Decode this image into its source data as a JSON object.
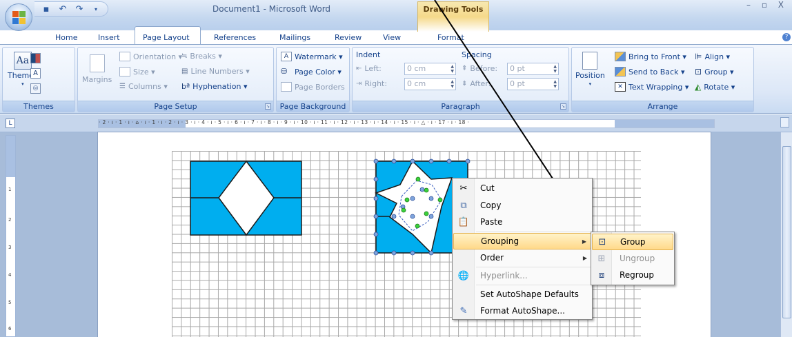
{
  "window": {
    "title": "Document1 - Microsoft Word",
    "contextual_tab_group": "Drawing Tools",
    "controls": "– ▫ X"
  },
  "tabs": [
    "Home",
    "Insert",
    "Page Layout",
    "References",
    "Mailings",
    "Review",
    "View",
    "Format"
  ],
  "active_tab": "Page Layout",
  "ribbon": {
    "themes": {
      "label": "Themes",
      "group": "Themes"
    },
    "page_setup": {
      "group": "Page Setup",
      "margins": "Margins",
      "orientation": "Orientation ▾",
      "size": "Size ▾",
      "columns": "Columns ▾",
      "breaks": "Breaks ▾",
      "line_numbers": "Line Numbers ▾",
      "hyphenation": "Hyphenation ▾"
    },
    "page_background": {
      "group": "Page Background",
      "watermark": "Watermark ▾",
      "page_color": "Page Color ▾",
      "page_borders": "Page Borders"
    },
    "paragraph": {
      "group": "Paragraph",
      "indent": "Indent",
      "left_label": "Left:",
      "left_value": "0 cm",
      "right_label": "Right:",
      "right_value": "0 cm",
      "spacing": "Spacing",
      "before_label": "Before:",
      "before_value": "0 pt",
      "after_label": "After:",
      "after_value": "0 pt"
    },
    "arrange": {
      "group": "Arrange",
      "position": "Position",
      "bring_to_front": "Bring to Front ▾",
      "send_to_back": "Send to Back ▾",
      "text_wrapping": "Text Wrapping ▾",
      "align": "Align ▾",
      "group_btn": "Group ▾",
      "rotate": "Rotate ▾"
    }
  },
  "ruler": {
    "text": "· 2 · ı · 1 · ı · ⌂ · ı · 1 · ı · 2 · ı · 3 · ı · 4 · ı · 5 · ı · 6 · ı · 7 · ı · 8 · ı · 9 · ı · 10 · ı · 11 · ı · 12 · ı · 13 · ı · 14 · ı · 15 · ı · △ · ı · 17 · ı · 18 ·",
    "vticks": [
      "1",
      "2",
      "3",
      "4",
      "5",
      "6"
    ]
  },
  "context_menu": {
    "items": [
      {
        "label": "Cut",
        "icon": "scissors-icon",
        "accel": "t"
      },
      {
        "label": "Copy",
        "icon": "copy-icon"
      },
      {
        "label": "Paste",
        "icon": "paste-icon"
      },
      {
        "label": "Grouping",
        "icon": "",
        "submenu": true,
        "highlighted": true
      },
      {
        "label": "Order",
        "icon": "",
        "submenu": true
      },
      {
        "label": "Hyperlink...",
        "icon": "hyperlink-icon",
        "disabled": true
      },
      {
        "label": "Set AutoShape Defaults",
        "icon": ""
      },
      {
        "label": "Format AutoShape...",
        "icon": "format-icon"
      }
    ]
  },
  "grouping_submenu": {
    "items": [
      {
        "label": "Group",
        "icon": "group-icon",
        "highlighted": true
      },
      {
        "label": "Ungroup",
        "icon": "ungroup-icon",
        "disabled": true
      },
      {
        "label": "Regroup",
        "icon": "regroup-icon"
      }
    ]
  },
  "colors": {
    "shape_fill": "#00aeef",
    "accent_blue": "#15428b",
    "highlight": "#ffd98a"
  }
}
